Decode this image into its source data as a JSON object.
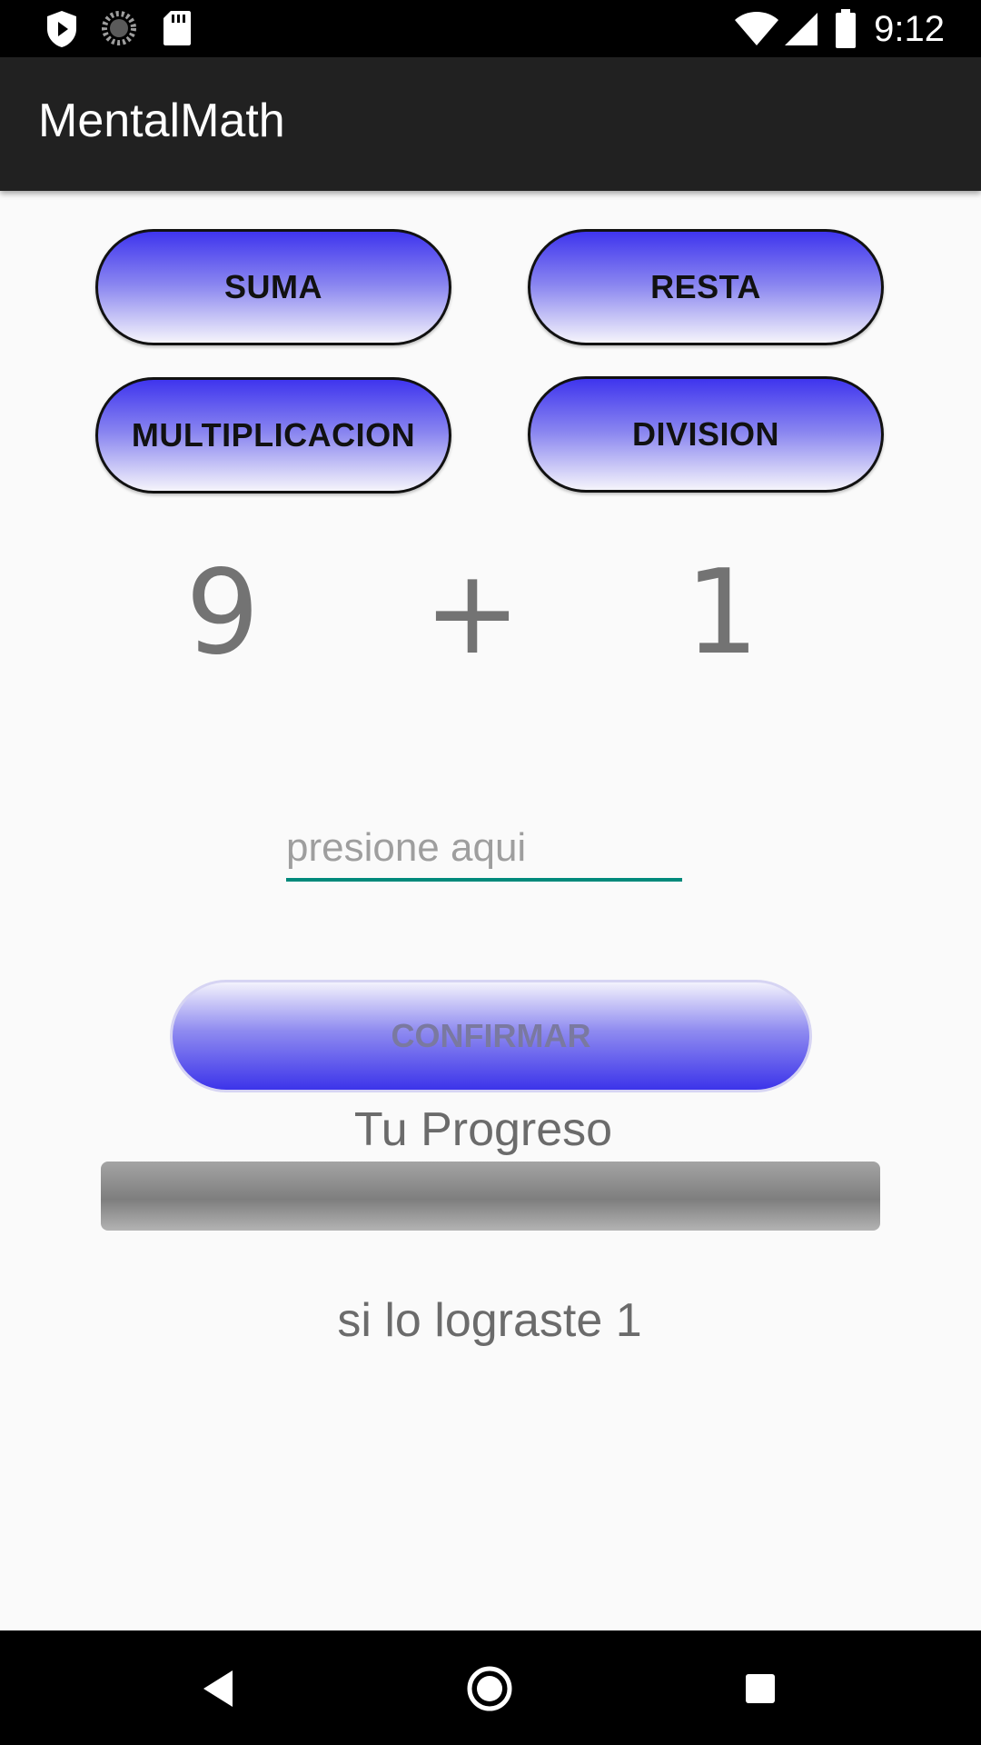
{
  "status_bar": {
    "time": "9:12",
    "icons": [
      "play-protect-icon",
      "sync-icon",
      "sd-card-icon",
      "wifi-icon",
      "signal-icon",
      "battery-icon"
    ]
  },
  "app_bar": {
    "title": "MentalMath"
  },
  "operations": {
    "suma": "SUMA",
    "resta": "RESTA",
    "multiplicacion": "MULTIPLICACION",
    "division": "DIVISION"
  },
  "problem": {
    "operand1": "9",
    "operator": "+",
    "operand2": "1"
  },
  "answer": {
    "value": "",
    "placeholder": "presione aqui"
  },
  "confirm": {
    "label": "CONFIRMAR"
  },
  "progress": {
    "title": "Tu Progreso",
    "value_percent": 0
  },
  "result": {
    "text": "si lo lograste 1"
  },
  "colors": {
    "accent": "#00897b",
    "button_blue": "#3f35ee",
    "app_bar": "#212121",
    "text_gray": "#737373"
  },
  "nav_bar": {
    "icons": [
      "back-icon",
      "home-icon",
      "recents-icon"
    ]
  }
}
